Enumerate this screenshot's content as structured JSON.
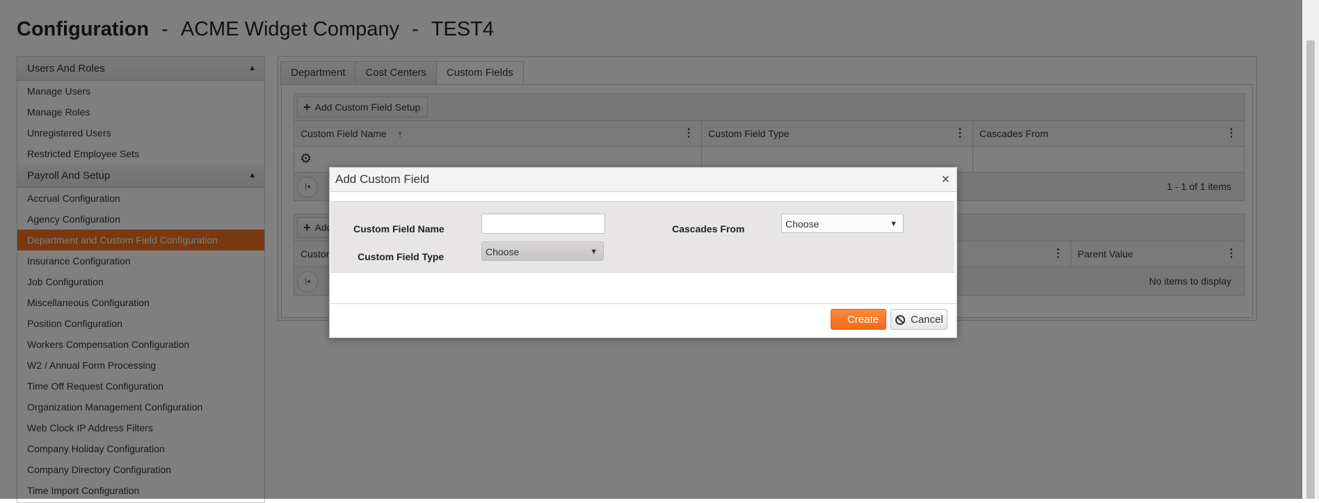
{
  "header": {
    "title_bold": "Configuration",
    "separator": "-",
    "company": "ACME Widget Company",
    "environment": "TEST4"
  },
  "sidebar": {
    "sections": [
      {
        "label": "Users And Roles",
        "items": [
          "Manage Users",
          "Manage Roles",
          "Unregistered Users",
          "Restricted Employee Sets"
        ]
      },
      {
        "label": "Payroll And Setup",
        "items": [
          "Accrual Configuration",
          "Agency Configuration",
          "Department and Custom Field Configuration",
          "Insurance Configuration",
          "Job Configuration",
          "Miscellaneous Configuration",
          "Position Configuration",
          "Workers Compensation Configuration",
          "W2 / Annual Form Processing",
          "Time Off Request Configuration",
          "Organization Management Configuration",
          "Web Clock IP Address Filters",
          "Company Holiday Configuration",
          "Company Directory Configuration",
          "Time Import Configuration"
        ]
      }
    ],
    "active_item": "Department and Custom Field Configuration"
  },
  "tabs": [
    "Department",
    "Cost Centers",
    "Custom Fields"
  ],
  "active_tab": "Custom Fields",
  "grid1": {
    "toolbar_button": "Add Custom Field Setup",
    "columns": [
      "Custom Field Name",
      "Custom Field Type",
      "Cascades From"
    ],
    "sort_indicator": "↑",
    "pager_info": "1 - 1 of 1 items"
  },
  "grid2": {
    "toolbar_button": "Add",
    "column_partial": "Custon",
    "columns_right": [
      "Parent Value"
    ],
    "pager_info": "No items to display"
  },
  "dialog": {
    "title": "Add Custom Field",
    "close": "×",
    "fields": {
      "name_label": "Custom Field Name",
      "name_value": "",
      "type_label": "Custom Field Type",
      "type_value": "Choose",
      "cascades_label": "Cascades From",
      "cascades_value": "Choose"
    },
    "buttons": {
      "create": "Create",
      "cancel": "Cancel"
    }
  },
  "colors": {
    "accent": "#f07020",
    "overlay": "rgba(0,0,0,0.5)"
  }
}
